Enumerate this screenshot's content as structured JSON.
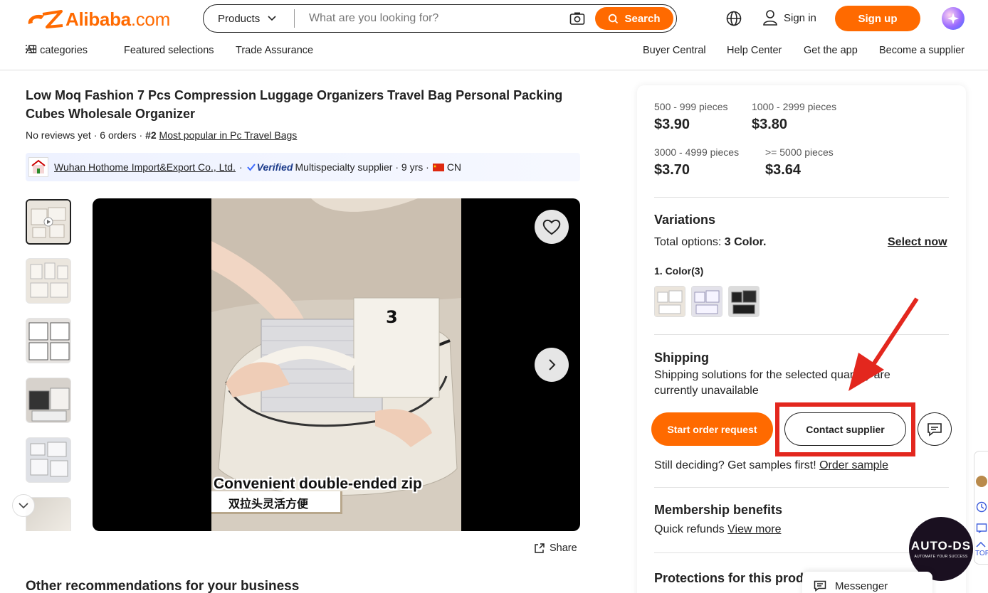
{
  "header": {
    "logo_text": "Alibaba",
    "logo_suffix": ".com",
    "search_category": "Products",
    "search_placeholder": "What are you looking for?",
    "search_button": "Search",
    "sign_in": "Sign in",
    "sign_up": "Sign up"
  },
  "subnav": {
    "all_categories": "All categories",
    "featured": "Featured selections",
    "trade_assurance": "Trade Assurance",
    "buyer_central": "Buyer Central",
    "help_center": "Help Center",
    "get_app": "Get the app",
    "become_supplier": "Become a supplier"
  },
  "product": {
    "title": "Low Moq Fashion 7 Pcs Compression Luggage Organizers Travel Bag Personal Packing Cubes Wholesale Organizer",
    "reviews": "No reviews yet",
    "orders": "6 orders",
    "rank": "#2",
    "rank_link": "Most popular in Pc Travel Bags",
    "supplier_name": "Wuhan Hothome Import&Export Co., Ltd.",
    "verified": "Verified",
    "supplier_type": "Multispecialty supplier",
    "years": "9 yrs",
    "country": "CN",
    "caption_en": "Convenient double-ended zip",
    "caption_cn": "双拉头灵活方便",
    "share": "Share"
  },
  "recommendations_title": "Other recommendations for your business",
  "pricing": [
    {
      "range": "500 - 999 pieces",
      "price": "$3.90"
    },
    {
      "range": "1000 - 2999 pieces",
      "price": "$3.80"
    },
    {
      "range": "3000 - 4999 pieces",
      "price": "$3.70"
    },
    {
      "range": ">= 5000 pieces",
      "price": "$3.64"
    }
  ],
  "variations": {
    "title": "Variations",
    "total_label": "Total options:",
    "total_value": "3 Color.",
    "select_now": "Select now",
    "color_label": "1. Color(3)"
  },
  "shipping": {
    "title": "Shipping",
    "message": "Shipping solutions for the selected quantity are currently unavailable"
  },
  "actions": {
    "start_order": "Start order request",
    "contact_supplier": "Contact supplier",
    "samples_text": "Still deciding? Get samples first!",
    "order_sample": "Order sample"
  },
  "membership": {
    "title": "Membership benefits",
    "text": "Quick refunds",
    "link": "View more"
  },
  "protections_title": "Protections for this product",
  "widgets": {
    "messenger": "Messenger",
    "autods_name": "AUTO-DS",
    "autods_tagline": "AUTOMATE YOUR SUCCESS",
    "top": "TOP"
  },
  "colors": {
    "brand": "#ff6a00",
    "annotation": "#e3271e"
  }
}
